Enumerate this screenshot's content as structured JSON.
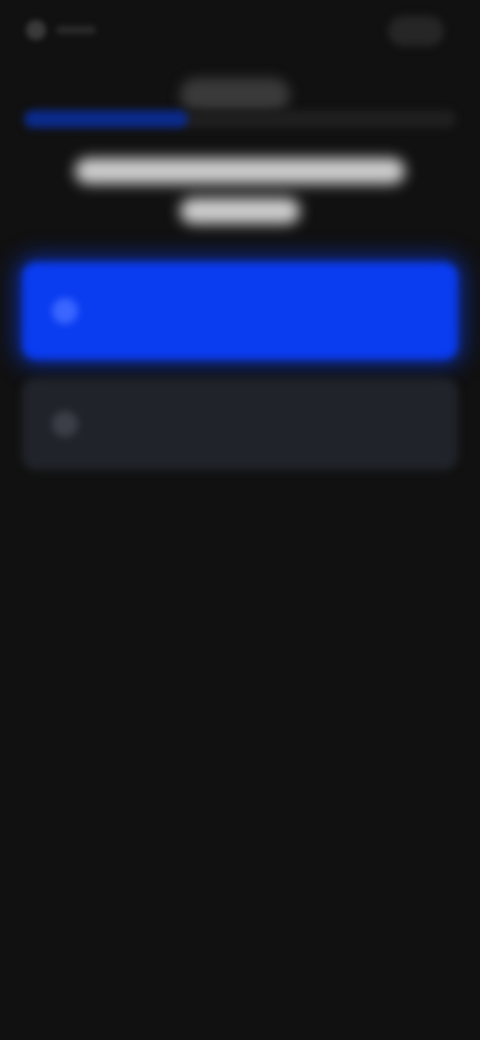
{
  "topbar": {
    "back_icon": "chevron-left-icon",
    "close_icon": "close-icon"
  },
  "progress": {
    "fraction": 0.38
  },
  "heading": {
    "text": ""
  },
  "options": [
    {
      "label": "",
      "icon": "radio-selected-icon",
      "selected": true
    },
    {
      "label": "",
      "icon": "radio-icon",
      "selected": false
    }
  ],
  "colors": {
    "background": "#111111",
    "accent": "#0a3cf0",
    "card": "#20232a"
  }
}
